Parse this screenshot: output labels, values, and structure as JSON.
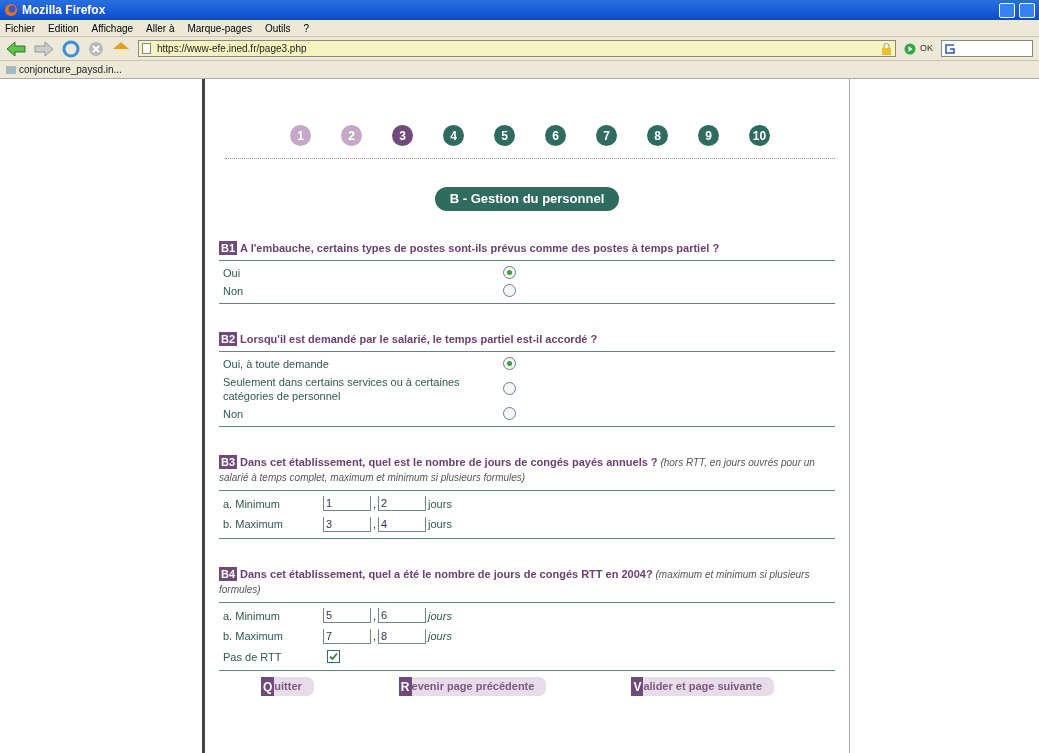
{
  "window": {
    "title": "Mozilla Firefox"
  },
  "menu": [
    "Fichier",
    "Edition",
    "Affichage",
    "Aller à",
    "Marque-pages",
    "Outils",
    "?"
  ],
  "address": {
    "value": "https://www-efe.ined.fr/page3.php"
  },
  "go_label": "OK",
  "bookmarks": [
    "conjoncture_paysd.in..."
  ],
  "steps": [
    {
      "label": "1",
      "selected": false,
      "visited": true
    },
    {
      "label": "2",
      "selected": false,
      "visited": true
    },
    {
      "label": "3",
      "selected": true
    },
    {
      "label": "4",
      "selected": false,
      "visited": false
    },
    {
      "label": "5",
      "selected": false,
      "visited": false
    },
    {
      "label": "6",
      "selected": false,
      "visited": false
    },
    {
      "label": "7",
      "selected": false,
      "visited": false
    },
    {
      "label": "8",
      "selected": false,
      "visited": false
    },
    {
      "label": "9",
      "selected": false,
      "visited": false
    },
    {
      "label": "10",
      "selected": false,
      "visited": false
    }
  ],
  "section_title": "B - Gestion du personnel",
  "questions": [
    {
      "kind": "radio",
      "code": "B1",
      "text": "A l'embauche, certains types de postes sont-ils prévus comme des postes à temps partiel ?",
      "options": [
        {
          "label": "Oui",
          "selected": true
        },
        {
          "label": "Non",
          "selected": false
        }
      ]
    },
    {
      "kind": "radio",
      "code": "B2",
      "text": "Lorsqu'il est demandé par le salarié, le temps partiel est-il accordé ?",
      "options": [
        {
          "label": "Oui, à toute demande",
          "selected": true
        },
        {
          "label": "Seulement dans certains services ou à certaines catégories de personnel",
          "selected": false
        },
        {
          "label": "Non",
          "selected": false
        }
      ]
    },
    {
      "kind": "numbers",
      "code": "B3",
      "text": "Dans cet établissement, quel est le nombre de jours de congés payés annuels ?",
      "note": "(hors RTT, en jours ouvrés pour un salarié à temps complet, maximum et minimum si plusieurs formules)",
      "rows": [
        {
          "label": "a. Minimum",
          "whole": "1",
          "separator": ",",
          "decimal": "2",
          "unit": "jours",
          "unit_italic": false
        },
        {
          "label": "b. Maximum",
          "whole": "3",
          "separator": ",",
          "decimal": "4",
          "unit": "jours",
          "unit_italic": false
        }
      ]
    },
    {
      "kind": "numbers",
      "code": "B4",
      "text": "Dans cet établissement, quel a été  le nombre de jours de congés RTT en 2004?",
      "note": "(maximum et minimum si plusieurs formules)",
      "rows": [
        {
          "label": "a. Minimum",
          "whole": "5",
          "separator": ",",
          "decimal": "6",
          "unit": "jours",
          "unit_italic": true
        },
        {
          "label": "b. Maximum",
          "whole": "7",
          "separator": ",",
          "decimal": "8",
          "unit": "jours",
          "unit_italic": true
        }
      ],
      "checkbox": {
        "label": "Pas de RTT",
        "checked": true
      }
    }
  ],
  "buttons": [
    {
      "key": "Q",
      "label": "uitter"
    },
    {
      "key": "R",
      "label": "evenir page précédente"
    },
    {
      "key": "V",
      "label": "alider et page suivante"
    }
  ]
}
